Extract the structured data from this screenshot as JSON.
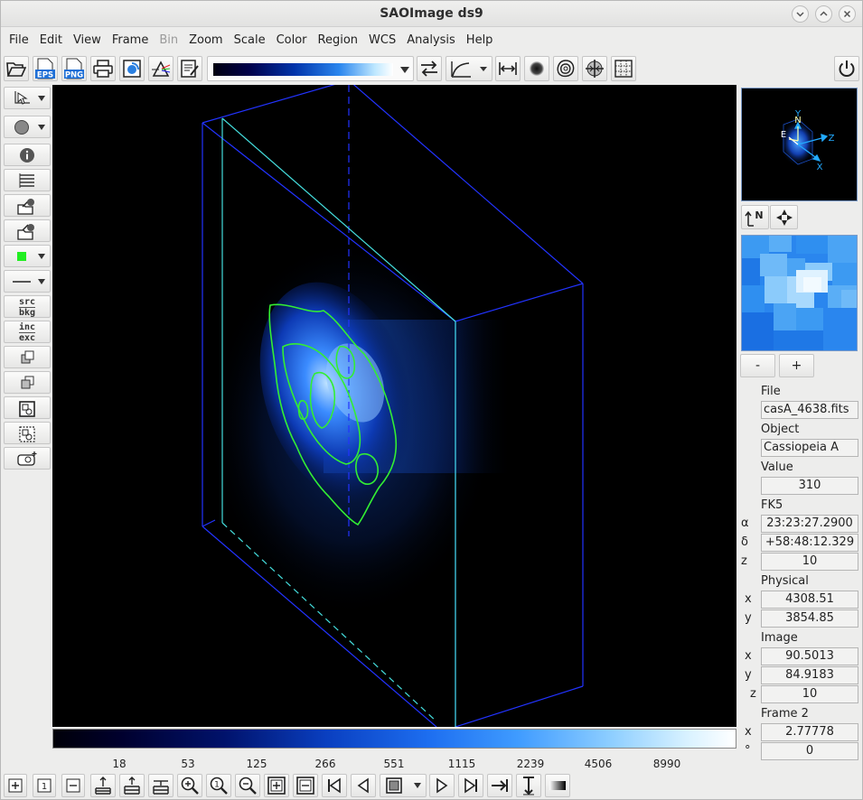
{
  "window": {
    "title": "SAOImage ds9"
  },
  "menu": [
    "File",
    "Edit",
    "View",
    "Frame",
    "Bin",
    "Zoom",
    "Scale",
    "Color",
    "Region",
    "WCS",
    "Analysis",
    "Help"
  ],
  "menu_disabled": [
    "Bin"
  ],
  "toolbar": {
    "eps_label": "EPS",
    "png_label": "PNG"
  },
  "left_toolbar": {
    "src": "src",
    "bkg": "bkg",
    "inc": "inc",
    "exc": "exc"
  },
  "panner": {
    "compass_n": "N",
    "compass_e": "E",
    "axis_x": "X",
    "axis_y": "Y",
    "axis_z": "Z"
  },
  "colorbar": {
    "ticks": [
      "18",
      "53",
      "125",
      "266",
      "551",
      "1115",
      "2239",
      "4506",
      "8990"
    ]
  },
  "zoom_buttons": {
    "minus": "-",
    "plus": "+"
  },
  "info": {
    "file_label": "File",
    "file_value": "casA_4638.fits",
    "object_label": "Object",
    "object_value": "Cassiopeia A",
    "value_label": "Value",
    "value_value": "310",
    "fk5_label": "FK5",
    "alpha_sym": "α",
    "alpha_value": "23:23:27.2900",
    "delta_sym": "δ",
    "delta_value": "+58:48:12.329",
    "z_sym": "z",
    "fk5_z_value": "10",
    "physical_label": "Physical",
    "x_sym": "x",
    "physical_x": "4308.51",
    "y_sym": "y",
    "physical_y": "3854.85",
    "image_label": "Image",
    "image_x": "90.5013",
    "image_y": "84.9183",
    "image_z": "10",
    "frame_label": "Frame 2",
    "frame_x": "2.77778",
    "deg_sym": "°",
    "frame_angle": "0"
  },
  "colors": {
    "contour": "#33ee33",
    "cube_box": "#2233ff",
    "cube_slice": "#44dddd",
    "panner_axes": "#22aaff"
  }
}
